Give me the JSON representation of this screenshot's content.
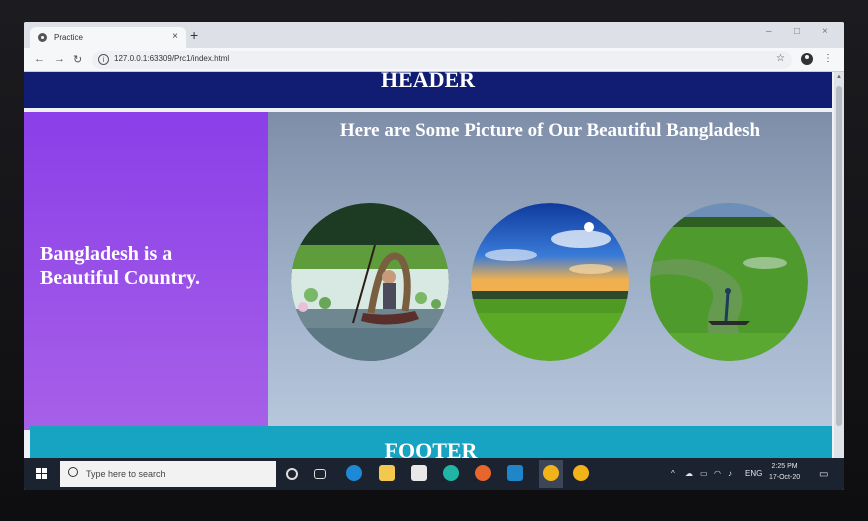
{
  "browser": {
    "tab_title": "Practice",
    "tab_close": "×",
    "new_tab": "+",
    "url": "127.0.0.1:63309/Prc1/index.html",
    "window_controls": [
      "–",
      "□",
      "×"
    ]
  },
  "page": {
    "header": "HEADER",
    "side_text": "Bangladesh is a Beautiful Country.",
    "main_title": "Here are Some Picture of Our Beautiful Bangladesh",
    "footer": "FOOTER",
    "pictures": [
      {
        "icon": "boat-lotus-photo"
      },
      {
        "icon": "sky-field-photo"
      },
      {
        "icon": "river-field-photo"
      }
    ]
  },
  "taskbar": {
    "search_placeholder": "Type here to search",
    "language": "ENG",
    "time": "2:25 PM",
    "date": "17-Oct-20"
  },
  "colors": {
    "header": "#111d73",
    "side": "#8a3fe8",
    "footer": "#17a3c2"
  }
}
